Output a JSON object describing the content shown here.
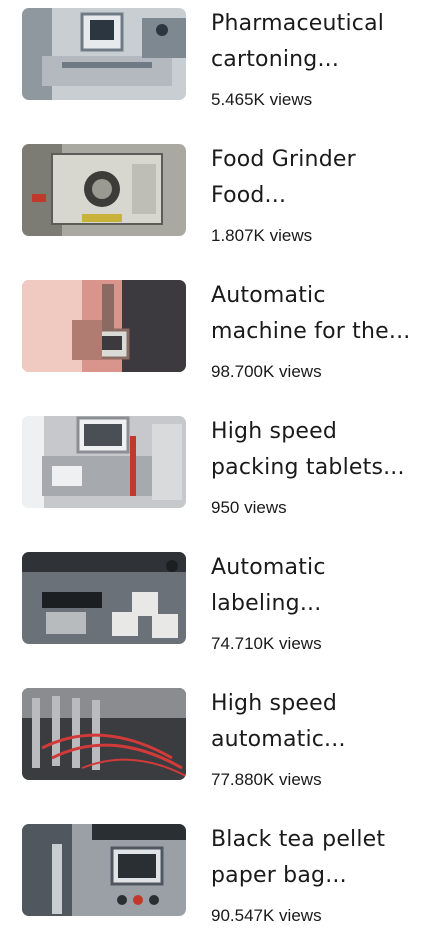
{
  "videos": [
    {
      "title_line1": "Pharmaceutical",
      "title_line2": "cartoning...",
      "views": "5.465K views",
      "palette": [
        "#c9ced3",
        "#6f7a84",
        "#e7eaed",
        "#2b3640"
      ]
    },
    {
      "title_line1": "Food Grinder",
      "title_line2": "Food...",
      "views": "1.807K views",
      "palette": [
        "#a9a9a2",
        "#5c5d58",
        "#d7d6cf",
        "#3d3c38"
      ]
    },
    {
      "title_line1": "Automatic",
      "title_line2": "machine for the...",
      "views": "98.700K views",
      "palette": [
        "#d9958c",
        "#8a6a62",
        "#f0c9c0",
        "#3c3a3e"
      ]
    },
    {
      "title_line1": "High speed",
      "title_line2": "packing tablets...",
      "views": "950 views",
      "palette": [
        "#c6c8cb",
        "#8b8f94",
        "#eef0f2",
        "#4a4f55"
      ]
    },
    {
      "title_line1": "Automatic",
      "title_line2": "labeling...",
      "views": "74.710K views",
      "palette": [
        "#6b7178",
        "#2f3338",
        "#e8e8e6",
        "#1c1f22"
      ]
    },
    {
      "title_line1": "High speed",
      "title_line2": "automatic...",
      "views": "77.880K views",
      "palette": [
        "#8a8c90",
        "#3a3c40",
        "#d23a3a",
        "#1e1f22"
      ]
    },
    {
      "title_line1": "Black tea pellet",
      "title_line2": "paper bag...",
      "views": "90.547K views",
      "palette": [
        "#9aa0a6",
        "#50575e",
        "#dfe3e6",
        "#2a2f34"
      ]
    }
  ]
}
